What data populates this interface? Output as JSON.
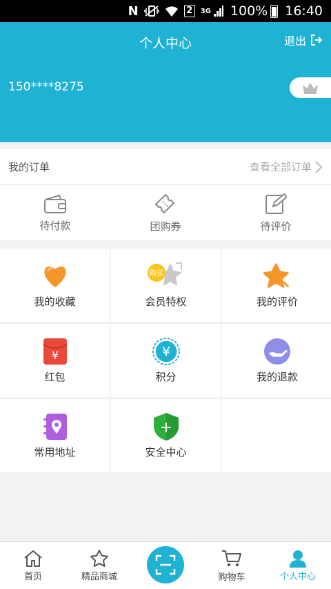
{
  "status_bar": {
    "sim_label": "2",
    "network": "3G",
    "battery": "100%",
    "time": "16:40"
  },
  "header": {
    "title": "个人中心",
    "logout_label": "退出",
    "phone": "150****8275",
    "background": "#1fb2d3"
  },
  "orders": {
    "label": "我的订单",
    "view_all": "查看全部订单",
    "items": [
      {
        "label": "待付款",
        "icon": "wallet-icon"
      },
      {
        "label": "团购券",
        "icon": "coupon-icon"
      },
      {
        "label": "待评价",
        "icon": "edit-icon"
      }
    ]
  },
  "grid": {
    "items": [
      {
        "label": "我的收藏",
        "icon": "heart-icon"
      },
      {
        "label": "会员特权",
        "icon": "vip-star-icon",
        "badge": "购买"
      },
      {
        "label": "我的评价",
        "icon": "star-comment-icon"
      },
      {
        "label": "红包",
        "icon": "red-envelope-icon",
        "glyph": "¥"
      },
      {
        "label": "积分",
        "icon": "points-coin-icon",
        "glyph": "¥"
      },
      {
        "label": "我的退款",
        "icon": "refund-hand-icon"
      },
      {
        "label": "常用地址",
        "icon": "address-book-icon"
      },
      {
        "label": "安全中心",
        "icon": "shield-icon",
        "glyph": "+"
      }
    ]
  },
  "tabbar": {
    "tabs": [
      {
        "label": "首页",
        "icon": "home-icon"
      },
      {
        "label": "精品商城",
        "icon": "star-outline-icon"
      },
      {
        "label": "",
        "icon": "scan-icon"
      },
      {
        "label": "购物车",
        "icon": "cart-icon"
      },
      {
        "label": "个人中心",
        "icon": "user-icon",
        "active": true
      }
    ]
  }
}
